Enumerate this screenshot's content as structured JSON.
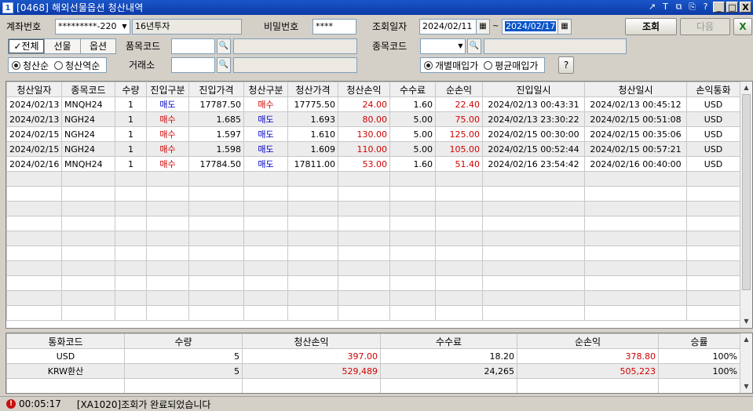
{
  "window": {
    "title": "[0468] 해외선물옵션 청산내역",
    "app_icon": "1",
    "controls": [
      "↗",
      "T",
      "⧉",
      "⎘",
      "?",
      "_",
      "□",
      "X"
    ]
  },
  "form": {
    "account_label": "계좌번호",
    "account_value": "*********-220",
    "account_name": "16년투자",
    "password_label": "비밀번호",
    "password_value": "****",
    "date_label": "조회일자",
    "date_from": "2024/02/11",
    "date_sep": "~",
    "date_to": "2024/02/17",
    "query_button": "조회",
    "next_button": "다음",
    "seg_options": [
      "전체",
      "선물",
      "옵션"
    ],
    "item_code_label": "품목코드",
    "stock_code_label": "종목코드",
    "sort_options": [
      "청산순",
      "청산역순"
    ],
    "exchange_label": "거래소",
    "price_options": [
      "개별매입가",
      "평균매입가"
    ],
    "help_button": "?",
    "check_mark": "✓",
    "search_glyph": "🔍",
    "calendar_glyph": "▦",
    "dropdown_glyph": "▼",
    "excel_glyph": "X"
  },
  "main_table": {
    "headers": [
      "청산일자",
      "종목코드",
      "수량",
      "진입구분",
      "진입가격",
      "청산구분",
      "청산가격",
      "청산손익",
      "수수료",
      "순손익",
      "진입일시",
      "청산일시",
      "손익통화"
    ],
    "rows": [
      [
        "2024/02/13",
        "MNQH24",
        "1",
        "매도",
        "17787.50",
        "매수",
        "17775.50",
        "24.00",
        "1.60",
        "22.40",
        "2024/02/13 00:43:31",
        "2024/02/13 00:45:12",
        "USD"
      ],
      [
        "2024/02/13",
        "NGH24",
        "1",
        "매수",
        "1.685",
        "매도",
        "1.693",
        "80.00",
        "5.00",
        "75.00",
        "2024/02/13 23:30:22",
        "2024/02/15 00:51:08",
        "USD"
      ],
      [
        "2024/02/15",
        "NGH24",
        "1",
        "매수",
        "1.597",
        "매도",
        "1.610",
        "130.00",
        "5.00",
        "125.00",
        "2024/02/15 00:30:00",
        "2024/02/15 00:35:06",
        "USD"
      ],
      [
        "2024/02/15",
        "NGH24",
        "1",
        "매수",
        "1.598",
        "매도",
        "1.609",
        "110.00",
        "5.00",
        "105.00",
        "2024/02/15 00:52:44",
        "2024/02/15 00:57:21",
        "USD"
      ],
      [
        "2024/02/16",
        "MNQH24",
        "1",
        "매수",
        "17784.50",
        "매도",
        "17811.00",
        "53.00",
        "1.60",
        "51.40",
        "2024/02/16 23:54:42",
        "2024/02/16 00:40:00",
        "USD"
      ]
    ]
  },
  "summary_table": {
    "headers": [
      "통화코드",
      "수량",
      "청산손익",
      "수수료",
      "순손익",
      "승률"
    ],
    "rows": [
      [
        "USD",
        "5",
        "397.00",
        "18.20",
        "378.80",
        "100%"
      ],
      [
        "KRW환산",
        "5",
        "529,489",
        "24,265",
        "505,223",
        "100%"
      ]
    ]
  },
  "status": {
    "time": "00:05:17",
    "message": "[XA1020]조회가 완료되었습니다"
  },
  "colors": {
    "profit": "#d00000",
    "sell": "#0000c8",
    "buy": "#d00000",
    "titlebar": "#1b56c8"
  }
}
